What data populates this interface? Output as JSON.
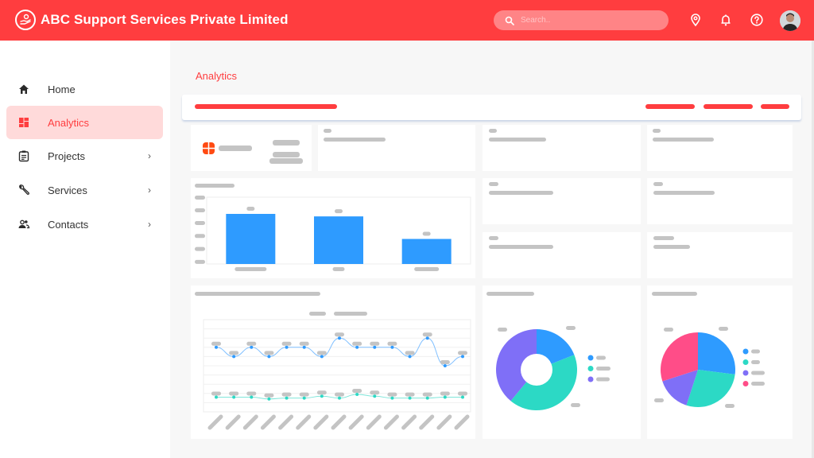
{
  "app": {
    "title": "ABC Support Services Private Limited",
    "logo_icon": "helping-hand-icon",
    "accent_color": "#ff3d3f"
  },
  "header": {
    "search": {
      "placeholder": "Search..",
      "value": ""
    },
    "icons": [
      "location-pin-icon",
      "bell-icon",
      "help-icon"
    ],
    "avatar": "user-avatar"
  },
  "sidebar": {
    "items": [
      {
        "label": "Home",
        "icon": "home-icon",
        "active": false,
        "has_submenu": false
      },
      {
        "label": "Analytics",
        "icon": "dashboard-icon",
        "active": true,
        "has_submenu": false
      },
      {
        "label": "Projects",
        "icon": "clipboard-icon",
        "active": false,
        "has_submenu": true
      },
      {
        "label": "Services",
        "icon": "wrench-icon",
        "active": false,
        "has_submenu": true
      },
      {
        "label": "Contacts",
        "icon": "people-icon",
        "active": false,
        "has_submenu": true
      }
    ],
    "chevron": "›"
  },
  "main": {
    "page_title": "Analytics",
    "toolbar": {
      "title_placeholder": true,
      "action_placeholders": 3
    }
  },
  "chart_data": [
    {
      "type": "bar",
      "title": "",
      "categories": [
        "",
        "",
        ""
      ],
      "values": [
        60,
        57,
        30
      ],
      "ylim": [
        0,
        80
      ],
      "colors": [
        "#2e9bff"
      ],
      "note": "labels rendered as skeleton placeholders"
    },
    {
      "type": "line",
      "title": "",
      "x": [
        1,
        2,
        3,
        4,
        5,
        6,
        7,
        8,
        9,
        10,
        11,
        12,
        13,
        14,
        15
      ],
      "series": [
        {
          "name": "",
          "color": "#2e9bff",
          "values": [
            7,
            6,
            7,
            6,
            7,
            7,
            6,
            8,
            7,
            7,
            7,
            6,
            8,
            5,
            6
          ]
        },
        {
          "name": "",
          "color": "#2cd9c5",
          "values": [
            1.6,
            1.6,
            1.6,
            1.4,
            1.5,
            1.5,
            1.7,
            1.5,
            1.9,
            1.7,
            1.5,
            1.5,
            1.5,
            1.6,
            1.6
          ]
        }
      ],
      "ylim": [
        0,
        10
      ],
      "grid": true,
      "legend": "top-center"
    },
    {
      "type": "pie",
      "variant": "donut",
      "title": "",
      "slices": [
        {
          "label": "",
          "value": 19,
          "color": "#2e9bff"
        },
        {
          "label": "",
          "value": 42,
          "color": "#2cd9c5"
        },
        {
          "label": "",
          "value": 39,
          "color": "#7f6ff7"
        }
      ],
      "legend": "right"
    },
    {
      "type": "pie",
      "title": "",
      "slices": [
        {
          "label": "",
          "value": 27,
          "color": "#2e9bff"
        },
        {
          "label": "",
          "value": 28,
          "color": "#2cd9c5"
        },
        {
          "label": "",
          "value": 15,
          "color": "#7f6ff7"
        },
        {
          "label": "",
          "value": 30,
          "color": "#ff4d88"
        }
      ],
      "legend": "right"
    }
  ]
}
